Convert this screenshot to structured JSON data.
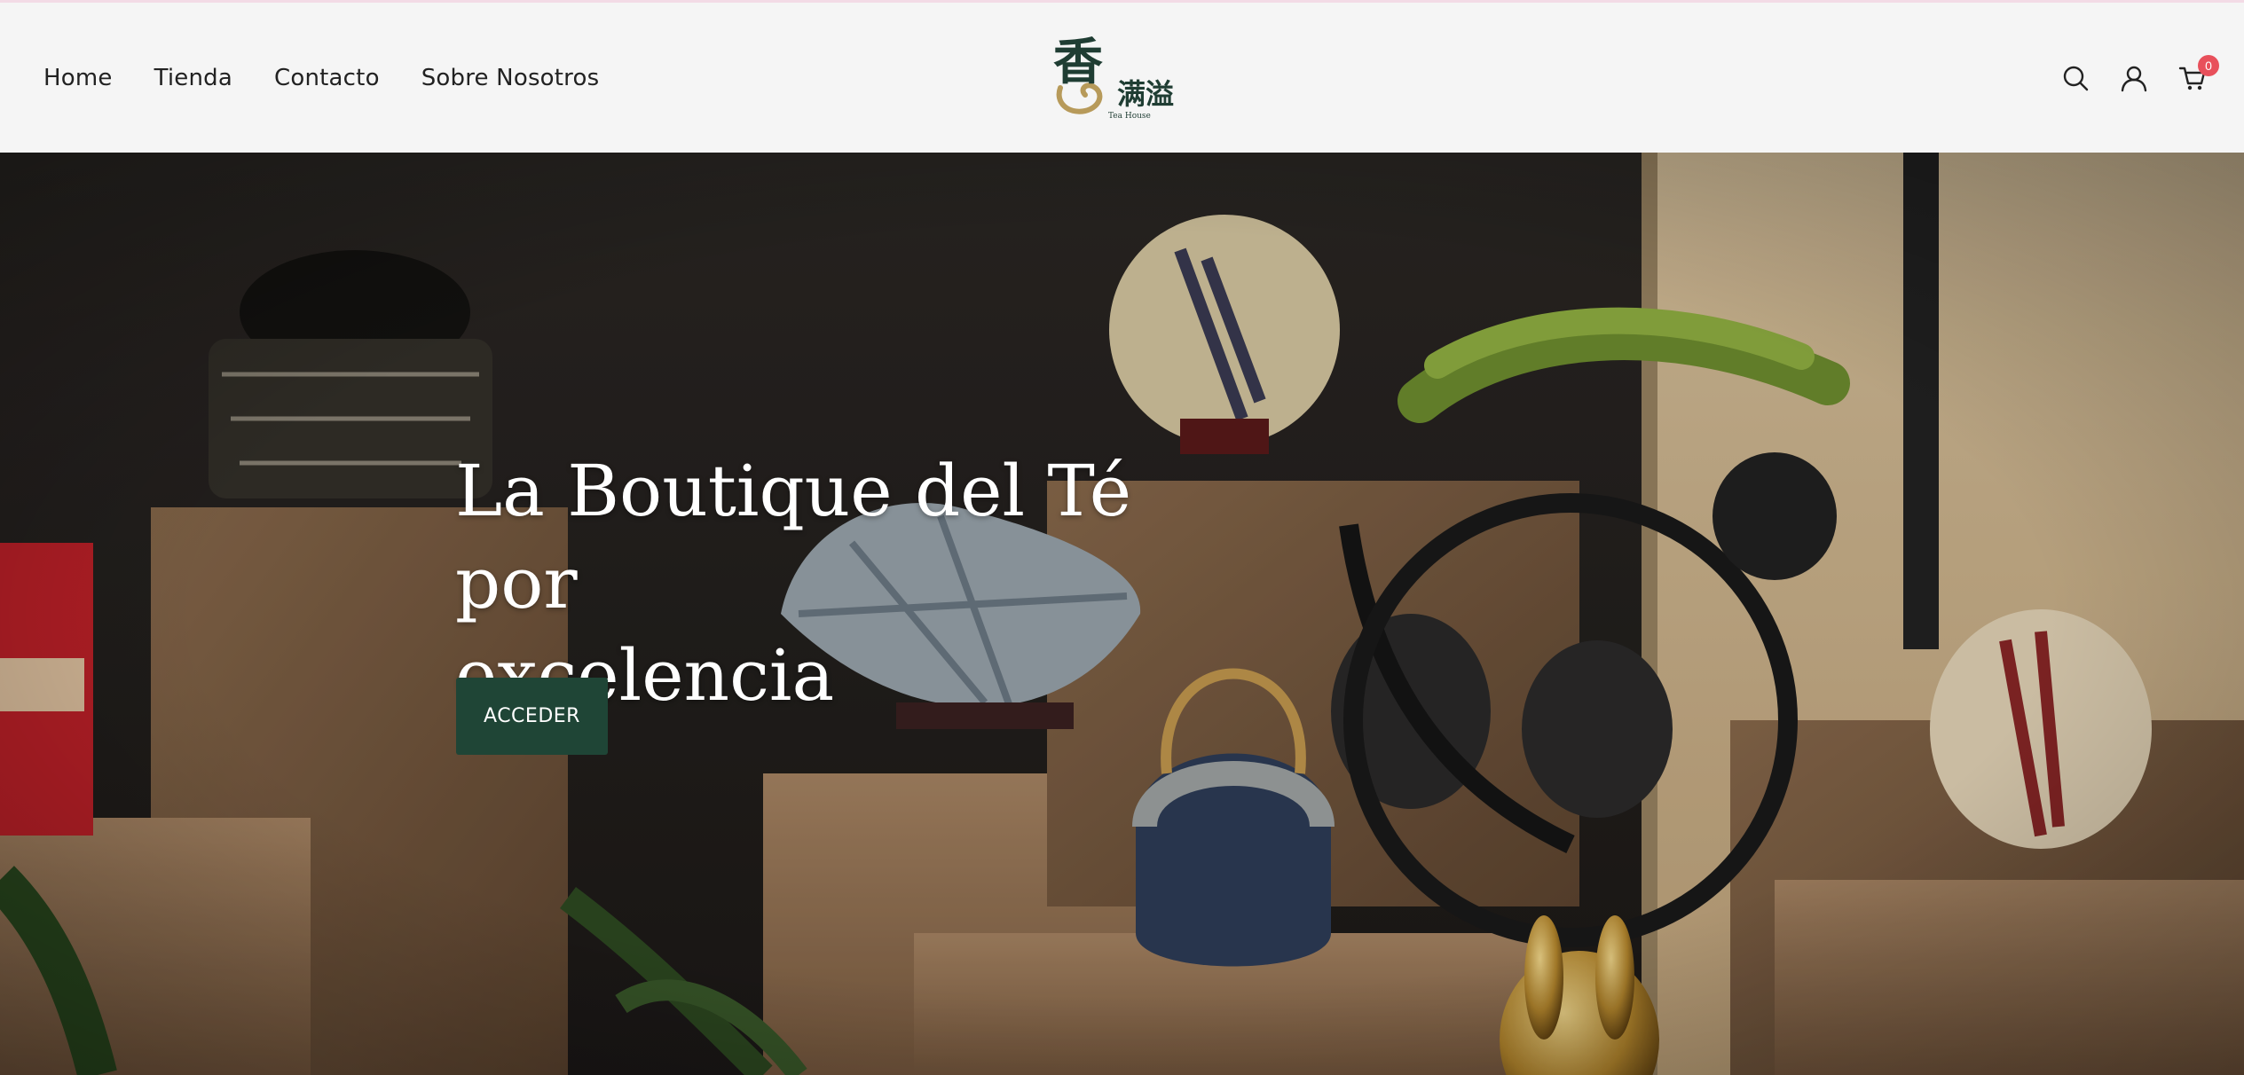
{
  "nav": {
    "items": [
      {
        "label": "Home"
      },
      {
        "label": "Tienda"
      },
      {
        "label": "Contacto"
      },
      {
        "label": "Sobre Nosotros"
      }
    ]
  },
  "logo": {
    "main_char": "香",
    "secondary_chars": "满溢",
    "subtitle": "Tea House"
  },
  "header_icons": {
    "search": "search-icon",
    "account": "user-icon",
    "cart": "cart-icon",
    "cart_count": "0"
  },
  "hero": {
    "title_line1": "La Boutique del Té por",
    "title_line2": "excelencia",
    "button_label": "ACCEDER"
  },
  "colors": {
    "button_bg": "#1f4536",
    "badge": "#e8505b",
    "header_bg": "#f5f5f5"
  }
}
